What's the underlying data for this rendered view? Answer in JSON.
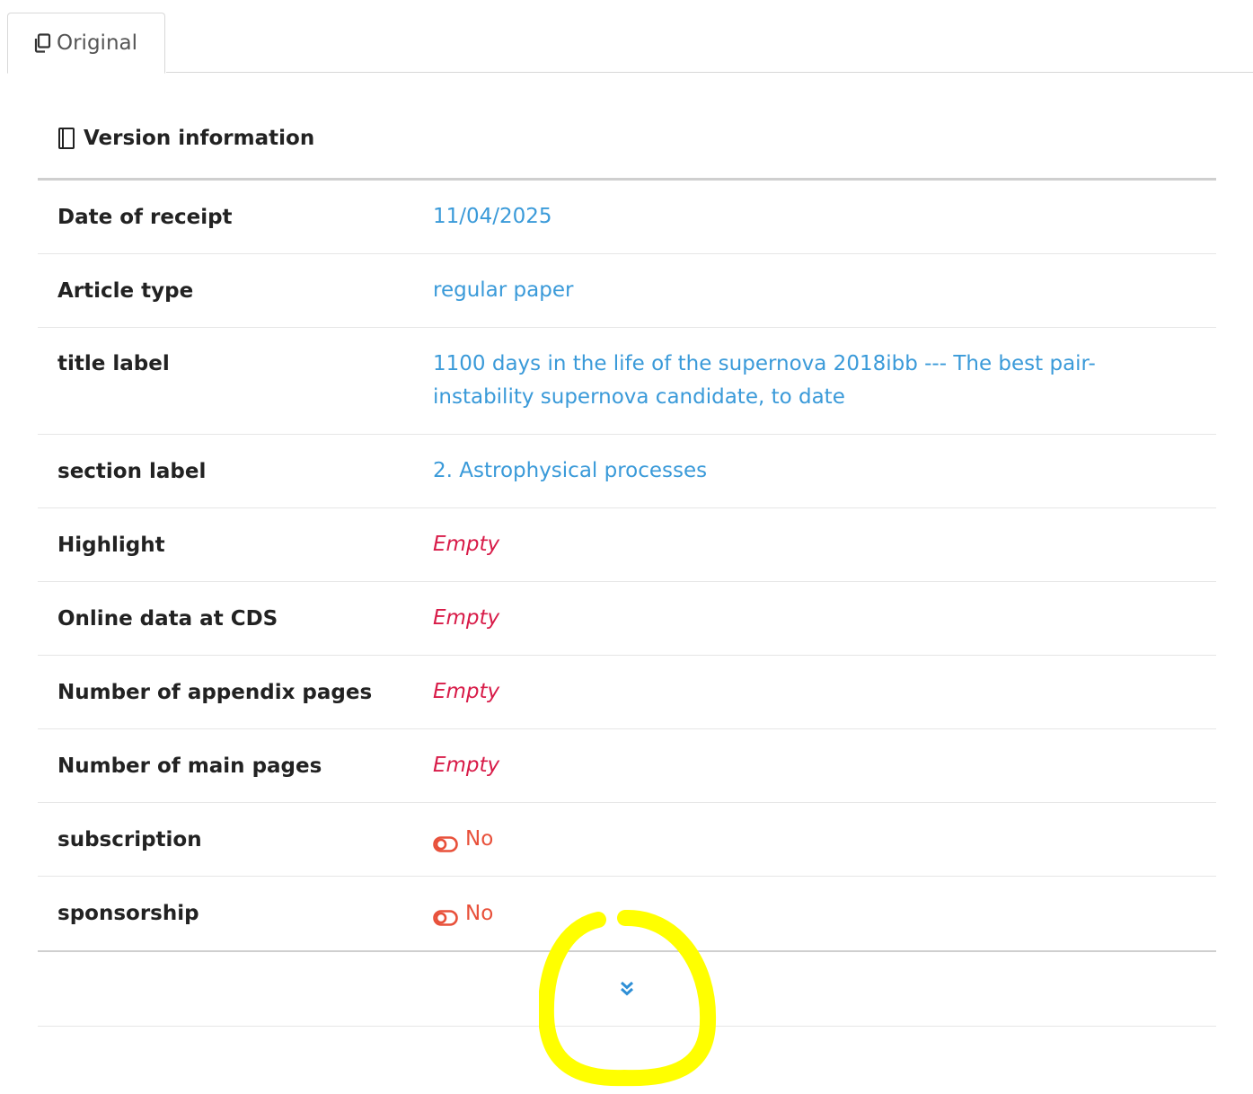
{
  "tabs": [
    {
      "label": "Original",
      "icon": "copy-icon",
      "active": true
    }
  ],
  "panel": {
    "title": "Version information",
    "icon": "book-icon"
  },
  "fields": [
    {
      "label": "Date of receipt",
      "value": "11/04/2025",
      "kind": "link"
    },
    {
      "label": "Article type",
      "value": "regular paper",
      "kind": "link"
    },
    {
      "label": "title label",
      "value": "1100 days in the life of the supernova 2018ibb --- The best pair-instability supernova candidate, to date",
      "kind": "link"
    },
    {
      "label": "section label",
      "value": "2. Astrophysical processes",
      "kind": "link"
    },
    {
      "label": "Highlight",
      "value": "Empty",
      "kind": "empty"
    },
    {
      "label": "Online data at CDS",
      "value": "Empty",
      "kind": "empty"
    },
    {
      "label": "Number of appendix pages",
      "value": "Empty",
      "kind": "empty"
    },
    {
      "label": "Number of main pages",
      "value": "Empty",
      "kind": "empty"
    },
    {
      "label": "subscription",
      "value": "No",
      "kind": "toggle-off",
      "icon": "toggle-off-icon"
    },
    {
      "label": "sponsorship",
      "value": "No",
      "kind": "toggle-off",
      "icon": "toggle-off-icon"
    }
  ],
  "expand": {
    "icon": "double-chevron-down-icon"
  },
  "colors": {
    "link": "#3a9ad9",
    "empty": "#d81b48",
    "no": "#e8503a",
    "annotation": "#ffff00"
  }
}
